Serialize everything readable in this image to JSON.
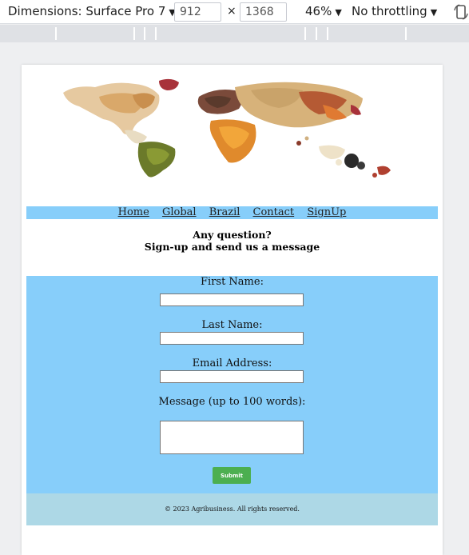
{
  "devtools": {
    "dimensions_label": "Dimensions: Surface Pro 7",
    "width_value": "912",
    "height_value": "1368",
    "times_symbol": "×",
    "zoom_label": "46%",
    "throttle_label": "No throttling",
    "caret": "▼"
  },
  "nav": {
    "items": [
      "Home",
      "Global",
      "Brazil",
      "Contact",
      "SignUp"
    ]
  },
  "intro": {
    "line1": "Any question?",
    "line2": "Sign-up and send us a message"
  },
  "form": {
    "first_name_label": "First Name:",
    "last_name_label": "Last Name:",
    "email_label": "Email Address:",
    "message_label": "Message (up to 100 words):",
    "submit_label": "Submit"
  },
  "footer": {
    "text": "© 2023 Agribusiness. All rights reserved."
  }
}
